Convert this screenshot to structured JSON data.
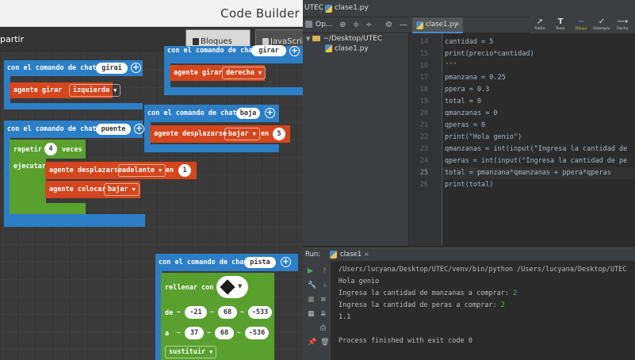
{
  "code_builder": {
    "title": "Code Builder",
    "share_label": "partir",
    "tabs": [
      {
        "label": "Bloques",
        "active": true
      },
      {
        "label": "JavaScrip",
        "active": false
      }
    ],
    "blocks": {
      "girai": {
        "header": "con el comando de chat",
        "command": "girai",
        "action": "agente girar",
        "direction": "izquierda"
      },
      "gir_right": {
        "header": "con el comando de chat",
        "command": "girar",
        "action": "agente girar",
        "direction": "derecha"
      },
      "baja": {
        "header": "con el comando de chat",
        "command": "baja",
        "action": "agente desplazarse",
        "direction": "bajar",
        "en": "en",
        "amount": "5"
      },
      "puente": {
        "header": "con el comando de chat",
        "command": "puente",
        "repeat_label": "repetir",
        "repeat_count": "4",
        "times_label": "veces",
        "do_label": "ejecutar",
        "move_action": "agente desplazarse",
        "move_direction": "adelante",
        "en": "en",
        "move_amount": "1",
        "place_action": "agente colocar",
        "place_direction": "bajar"
      },
      "pista": {
        "header": "con el comando de chat",
        "command": "pista",
        "fill_label": "rellenar con",
        "from_label": "de",
        "from": [
          "-21",
          "68",
          "-533"
        ],
        "to_label": "a",
        "to": [
          "37",
          "68",
          "-536"
        ],
        "mode": "sustituir"
      }
    }
  },
  "ide": {
    "titlebar": {
      "project": "UTEC",
      "file": "clase1.py"
    },
    "subbar": {
      "project_dropdown": "Op..."
    },
    "editor_tab": "clase1.py",
    "toolbar": [
      {
        "label": "Ratón",
        "icon": "cursor-icon"
      },
      {
        "label": "Texto",
        "icon": "text-icon"
      },
      {
        "label": "Dibujo",
        "icon": "draw-icon"
      },
      {
        "label": "Estampar",
        "icon": "stamp-icon"
      },
      {
        "label": "Flecha",
        "icon": "arrow-icon"
      }
    ],
    "project_tree": [
      {
        "label": "~/Desktop/UTEC",
        "type": "folder"
      },
      {
        "label": "clase1.py",
        "type": "file"
      }
    ],
    "code_lines": [
      {
        "num": "14",
        "text": "cantidad = 5"
      },
      {
        "num": "15",
        "text": "print(precio*cantidad)"
      },
      {
        "num": "16",
        "text": "\"\"\""
      },
      {
        "num": "17",
        "text": "pmanzana = 0.25"
      },
      {
        "num": "18",
        "text": "ppera = 0.3"
      },
      {
        "num": "19",
        "text": "total = 0"
      },
      {
        "num": "20",
        "text": "qmanzanas = 0"
      },
      {
        "num": "21",
        "text": "qperas = 0"
      },
      {
        "num": "22",
        "text": "print(\"Hola genio\")"
      },
      {
        "num": "23",
        "text": "qmanzanas = int(input(\"Ingresa la cantidad de"
      },
      {
        "num": "24",
        "text": "qperas = int(input(\"Ingresa la cantidad de pe"
      },
      {
        "num": "25",
        "text": "total = pmanzana*qmanzanas + ppera*qperas"
      },
      {
        "num": "26",
        "text": "print(total)"
      }
    ],
    "run": {
      "label": "Run:",
      "config": "clase1",
      "output": [
        "/Users/lucyana/Desktop/UTEC/venv/bin/python /Users/lucyana/Desktop/UTEC",
        "Hola genio",
        "Ingresa la cantidad de manzanas a comprar: ",
        "Ingresa la cantidad de peras a comprar: ",
        "1.1",
        "",
        "Process finished with exit code 0"
      ],
      "inputs": [
        "2",
        "2"
      ]
    }
  }
}
